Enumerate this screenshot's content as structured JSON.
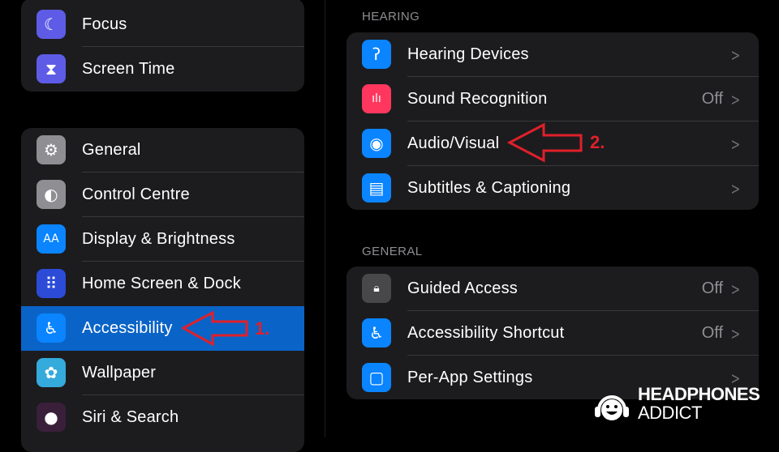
{
  "sidebar": {
    "group1": [
      {
        "label": "Focus",
        "icon": "moon-icon",
        "glyph": "☾",
        "color": "#5e5ce6"
      },
      {
        "label": "Screen Time",
        "icon": "hourglass-icon",
        "glyph": "⧗",
        "color": "#5e5ce6"
      }
    ],
    "group2": [
      {
        "label": "General",
        "icon": "gear-icon",
        "glyph": "⚙",
        "color": "#8e8e93"
      },
      {
        "label": "Control Centre",
        "icon": "toggles-icon",
        "glyph": "◐",
        "color": "#8e8e93"
      },
      {
        "label": "Display & Brightness",
        "icon": "text-size-icon",
        "glyph": "AA",
        "color": "#0a84ff"
      },
      {
        "label": "Home Screen & Dock",
        "icon": "home-grid-icon",
        "glyph": "⠿",
        "color": "#2c4bd6"
      },
      {
        "label": "Accessibility",
        "icon": "accessibility-icon",
        "glyph": "♿",
        "color": "#0a84ff",
        "selected": true
      },
      {
        "label": "Wallpaper",
        "icon": "flower-icon",
        "glyph": "✿",
        "color": "#35aadc"
      },
      {
        "label": "Siri & Search",
        "icon": "siri-icon",
        "glyph": "●",
        "color": "#3a1f3a"
      }
    ]
  },
  "main": {
    "hearing": {
      "header": "HEARING",
      "items": [
        {
          "label": "Hearing Devices",
          "icon": "ear-icon",
          "glyph": "ʔ",
          "color": "#0a84ff",
          "value": ""
        },
        {
          "label": "Sound Recognition",
          "icon": "sound-wave-icon",
          "glyph": "ılı",
          "color": "#ff375f",
          "value": "Off"
        },
        {
          "label": "Audio/Visual",
          "icon": "speaker-eye-icon",
          "glyph": "◉",
          "color": "#0a84ff",
          "value": ""
        },
        {
          "label": "Subtitles & Captioning",
          "icon": "caption-bubble-icon",
          "glyph": "▤",
          "color": "#0a84ff",
          "value": ""
        }
      ]
    },
    "general": {
      "header": "GENERAL",
      "items": [
        {
          "label": "Guided Access",
          "icon": "lock-icon",
          "glyph": "🔒︎",
          "color": "#48484a",
          "value": "Off"
        },
        {
          "label": "Accessibility Shortcut",
          "icon": "accessibility-icon",
          "glyph": "♿",
          "color": "#0a84ff",
          "value": "Off"
        },
        {
          "label": "Per-App Settings",
          "icon": "app-check-icon",
          "glyph": "▢",
          "color": "#0a84ff",
          "value": ""
        }
      ]
    }
  },
  "annotations": {
    "step1": "1.",
    "step2": "2.",
    "color": "#e0202a"
  },
  "watermark": {
    "line1": "HEADPHONES",
    "line2": "ADDICT"
  }
}
